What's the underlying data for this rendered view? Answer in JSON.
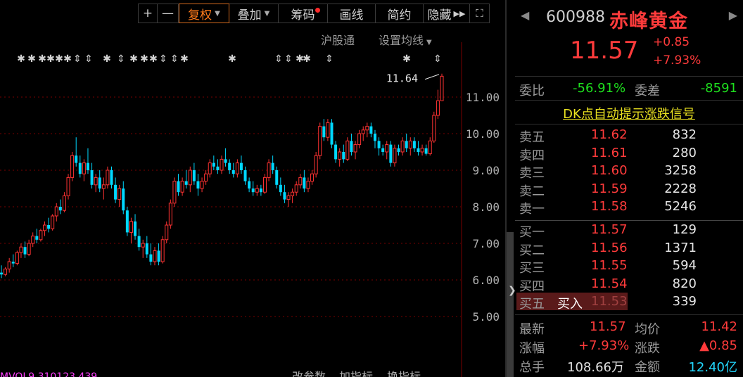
{
  "toolbar": {
    "plus": "+",
    "minus": "—",
    "fuquan": "复权",
    "diejia": "叠加",
    "chouma": "筹码",
    "huaxian": "画线",
    "jianyue": "简约",
    "yincang": "隐藏",
    "fullscreen": "⛶"
  },
  "subbar": {
    "hugutong": "沪股通",
    "set_ma": "设置均线"
  },
  "bottom_labels": [
    "改参数",
    "加指标",
    "换指标"
  ],
  "bottom_ticker_text": "MVOL9 310123 439",
  "chart_data": {
    "type": "candlestick",
    "y_axis_ticks": [
      "11.00",
      "10.00",
      "9.00",
      "8.00",
      "7.00",
      "6.00",
      "5.00"
    ],
    "ylim": [
      4.5,
      11.7
    ],
    "high_label": "11.64",
    "colors": {
      "up": "#ff3232",
      "down": "#00d8ff",
      "grid": "#7a0000"
    },
    "candles": [
      [
        6.2,
        6.4,
        6.05,
        6.15
      ],
      [
        6.15,
        6.35,
        6.1,
        6.3
      ],
      [
        6.3,
        6.6,
        6.2,
        6.5
      ],
      [
        6.5,
        6.7,
        6.35,
        6.45
      ],
      [
        6.45,
        6.8,
        6.4,
        6.75
      ],
      [
        6.75,
        7.0,
        6.6,
        6.9
      ],
      [
        6.9,
        7.05,
        6.6,
        6.7
      ],
      [
        6.7,
        7.1,
        6.65,
        7.0
      ],
      [
        7.0,
        7.3,
        6.9,
        7.2
      ],
      [
        7.2,
        7.4,
        7.0,
        7.1
      ],
      [
        7.1,
        7.4,
        7.05,
        7.35
      ],
      [
        7.35,
        7.6,
        7.2,
        7.5
      ],
      [
        7.5,
        7.7,
        7.3,
        7.4
      ],
      [
        7.4,
        7.8,
        7.35,
        7.75
      ],
      [
        7.75,
        8.1,
        7.6,
        8.0
      ],
      [
        8.0,
        8.2,
        7.8,
        7.9
      ],
      [
        7.9,
        8.4,
        7.85,
        8.3
      ],
      [
        8.3,
        8.9,
        8.2,
        8.8
      ],
      [
        8.8,
        9.5,
        8.7,
        9.4
      ],
      [
        9.4,
        9.9,
        9.1,
        9.2
      ],
      [
        9.2,
        9.4,
        8.8,
        8.9
      ],
      [
        8.9,
        9.3,
        8.7,
        9.2
      ],
      [
        9.2,
        9.6,
        8.9,
        9.0
      ],
      [
        9.0,
        9.2,
        8.5,
        8.6
      ],
      [
        8.6,
        8.9,
        8.4,
        8.8
      ],
      [
        8.8,
        9.0,
        8.4,
        8.5
      ],
      [
        8.5,
        8.8,
        8.2,
        8.6
      ],
      [
        8.6,
        9.1,
        8.5,
        9.0
      ],
      [
        9.0,
        9.1,
        8.5,
        8.6
      ],
      [
        8.6,
        8.8,
        8.1,
        8.2
      ],
      [
        8.2,
        8.6,
        8.0,
        8.5
      ],
      [
        8.5,
        8.7,
        7.8,
        7.9
      ],
      [
        7.9,
        8.0,
        7.2,
        7.3
      ],
      [
        7.3,
        7.7,
        7.0,
        7.6
      ],
      [
        7.6,
        7.8,
        7.1,
        7.2
      ],
      [
        7.2,
        7.4,
        6.8,
        6.9
      ],
      [
        6.9,
        7.1,
        6.6,
        7.0
      ],
      [
        7.0,
        7.2,
        6.6,
        6.7
      ],
      [
        6.7,
        7.0,
        6.4,
        6.5
      ],
      [
        6.5,
        6.9,
        6.4,
        6.8
      ],
      [
        6.8,
        7.0,
        6.4,
        6.5
      ],
      [
        6.5,
        7.2,
        6.45,
        7.1
      ],
      [
        7.1,
        7.6,
        7.0,
        7.5
      ],
      [
        7.5,
        8.2,
        7.4,
        8.1
      ],
      [
        8.1,
        8.8,
        8.0,
        8.7
      ],
      [
        8.7,
        8.9,
        8.3,
        8.4
      ],
      [
        8.4,
        8.8,
        8.3,
        8.7
      ],
      [
        8.7,
        9.0,
        8.5,
        8.6
      ],
      [
        8.6,
        9.1,
        8.4,
        9.0
      ],
      [
        9.0,
        9.2,
        8.6,
        8.7
      ],
      [
        8.7,
        8.9,
        8.3,
        8.5
      ],
      [
        8.5,
        8.8,
        8.4,
        8.7
      ],
      [
        8.7,
        9.0,
        8.6,
        8.9
      ],
      [
        8.9,
        9.3,
        8.8,
        9.2
      ],
      [
        9.2,
        9.4,
        9.0,
        9.1
      ],
      [
        9.1,
        9.3,
        8.9,
        9.0
      ],
      [
        9.0,
        9.4,
        8.9,
        9.3
      ],
      [
        9.3,
        9.6,
        9.1,
        9.2
      ],
      [
        9.2,
        9.3,
        8.9,
        9.0
      ],
      [
        9.0,
        9.2,
        8.8,
        8.9
      ],
      [
        8.9,
        9.3,
        8.8,
        9.2
      ],
      [
        9.2,
        9.4,
        8.9,
        9.0
      ],
      [
        9.0,
        9.1,
        8.6,
        8.7
      ],
      [
        8.7,
        8.8,
        8.4,
        8.5
      ],
      [
        8.5,
        8.7,
        8.3,
        8.4
      ],
      [
        8.4,
        8.6,
        8.3,
        8.5
      ],
      [
        8.5,
        8.6,
        8.3,
        8.4
      ],
      [
        8.4,
        8.9,
        8.35,
        8.8
      ],
      [
        8.8,
        9.3,
        8.7,
        9.2
      ],
      [
        9.2,
        9.4,
        8.9,
        9.0
      ],
      [
        9.0,
        9.1,
        8.5,
        8.6
      ],
      [
        8.6,
        8.8,
        8.3,
        8.4
      ],
      [
        8.4,
        8.6,
        8.1,
        8.2
      ],
      [
        8.2,
        8.4,
        8.0,
        8.3
      ],
      [
        8.3,
        8.5,
        8.1,
        8.4
      ],
      [
        8.4,
        8.7,
        8.3,
        8.6
      ],
      [
        8.6,
        8.9,
        8.5,
        8.8
      ],
      [
        8.8,
        9.0,
        8.4,
        8.5
      ],
      [
        8.5,
        8.8,
        8.4,
        8.7
      ],
      [
        8.7,
        9.0,
        8.6,
        8.9
      ],
      [
        8.9,
        9.5,
        8.8,
        9.4
      ],
      [
        9.4,
        10.3,
        9.3,
        10.2
      ],
      [
        10.2,
        10.4,
        9.8,
        9.9
      ],
      [
        9.9,
        10.4,
        9.8,
        10.3
      ],
      [
        10.3,
        10.4,
        9.6,
        9.7
      ],
      [
        9.7,
        9.8,
        9.2,
        9.3
      ],
      [
        9.3,
        9.6,
        9.1,
        9.5
      ],
      [
        9.5,
        9.7,
        9.2,
        9.3
      ],
      [
        9.3,
        9.9,
        9.25,
        9.8
      ],
      [
        9.8,
        10.0,
        9.4,
        9.5
      ],
      [
        9.5,
        9.8,
        9.3,
        9.7
      ],
      [
        9.7,
        10.1,
        9.6,
        10.0
      ],
      [
        10.0,
        10.2,
        9.8,
        10.1
      ],
      [
        10.1,
        10.3,
        9.9,
        10.2
      ],
      [
        10.2,
        10.3,
        9.9,
        10.0
      ],
      [
        10.0,
        10.1,
        9.6,
        9.8
      ],
      [
        9.8,
        9.9,
        9.4,
        9.6
      ],
      [
        9.6,
        9.7,
        9.4,
        9.5
      ],
      [
        9.5,
        9.8,
        9.3,
        9.7
      ],
      [
        9.7,
        9.8,
        9.1,
        9.2
      ],
      [
        9.2,
        9.7,
        9.1,
        9.6
      ],
      [
        9.6,
        9.7,
        9.4,
        9.5
      ],
      [
        9.5,
        9.9,
        9.4,
        9.8
      ],
      [
        9.8,
        10.0,
        9.5,
        9.6
      ],
      [
        9.6,
        9.9,
        9.4,
        9.8
      ],
      [
        9.8,
        9.9,
        9.5,
        9.6
      ],
      [
        9.6,
        9.8,
        9.4,
        9.5
      ],
      [
        9.5,
        9.7,
        9.4,
        9.6
      ],
      [
        9.6,
        9.7,
        9.4,
        9.45
      ],
      [
        9.45,
        9.9,
        9.4,
        9.8
      ],
      [
        9.8,
        10.6,
        9.75,
        10.5
      ],
      [
        10.5,
        11.2,
        10.4,
        10.9
      ],
      [
        10.9,
        11.64,
        10.9,
        11.57
      ]
    ]
  },
  "quote": {
    "code": "600988",
    "name": "赤峰黄金",
    "price": "11.57",
    "change": "+0.85",
    "change_pct": "+7.93%",
    "weibi_label": "委比",
    "weibi": "-56.91%",
    "weicha_label": "委差",
    "weicha": "-8591",
    "dk_link": "DK点自动提示涨跌信号",
    "asks": [
      {
        "label": "卖五",
        "price": "11.62",
        "vol": "832"
      },
      {
        "label": "卖四",
        "price": "11.61",
        "vol": "280"
      },
      {
        "label": "卖三",
        "price": "11.60",
        "vol": "3258"
      },
      {
        "label": "卖二",
        "price": "11.59",
        "vol": "2228"
      },
      {
        "label": "卖一",
        "price": "11.58",
        "vol": "5246"
      }
    ],
    "bids": [
      {
        "label": "买一",
        "price": "11.57",
        "vol": "129"
      },
      {
        "label": "买二",
        "price": "11.56",
        "vol": "1371"
      },
      {
        "label": "买三",
        "price": "11.55",
        "vol": "594"
      },
      {
        "label": "买四",
        "price": "11.54",
        "vol": "820"
      },
      {
        "label": "买五",
        "price": "11.53",
        "vol": "339",
        "buy_button": "买入"
      }
    ],
    "stats": {
      "zuixin_label": "最新",
      "zuixin": "11.57",
      "junjia_label": "均价",
      "junjia": "11.42",
      "zhangfu_label": "涨幅",
      "zhangfu": "+7.93%",
      "zhangdie_label": "涨跌",
      "zhangdie": "▲0.85",
      "zongshou_label": "总手",
      "zongshou": "108.66万",
      "jine_label": "金额",
      "jine": "12.40亿"
    }
  }
}
